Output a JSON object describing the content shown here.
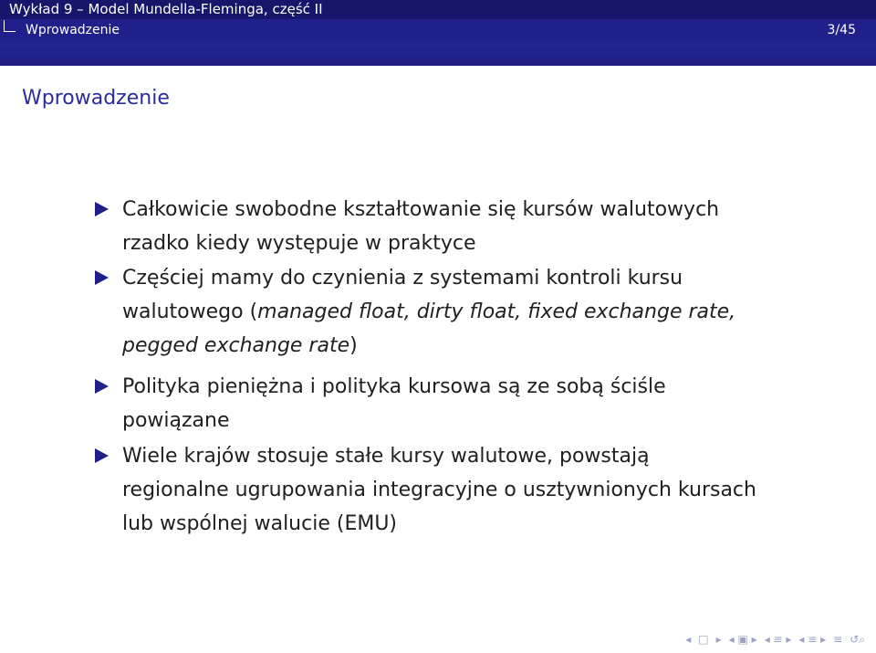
{
  "header": {
    "lecture_title": "Wykład 9 – Model Mundella-Fleminga, część II",
    "section_name": "Wprowadzenie",
    "page_number": "3/45"
  },
  "frame": {
    "title": "Wprowadzenie"
  },
  "bullets": [
    {
      "lines": [
        "Całkowicie swobodne kształtowanie się kursów walutowych",
        "rzadko kiedy występuje w praktyce"
      ]
    },
    {
      "lines": [
        "Częściej mamy do czynienia z systemami kontroli kursu",
        "walutowego (",
        "managed float, dirty float, fixed exchange rate,",
        "pegged exchange rate",
        ")"
      ]
    },
    {
      "lines": [
        "Polityka pieniężna i polityka kursowa są ze sobą ściśle",
        "powiązane"
      ]
    },
    {
      "lines": [
        "Wiele krajów stosuje stałe kursy walutowe, powstają",
        "regionalne ugrupowania integracyjne o usztywnionych kursach",
        "lub wspólnej walucie (EMU)"
      ]
    }
  ],
  "navigation": {
    "icons": [
      "nav-left-arrow",
      "nav-frame-box",
      "nav-right-arrow",
      "nav-subsection",
      "nav-section",
      "nav-presentation",
      "nav-search"
    ]
  },
  "colors": {
    "header_background": "#1f1f7a",
    "title_color": "#2b2b9a",
    "bullet_color": "#20208a",
    "text_color": "#202020"
  }
}
